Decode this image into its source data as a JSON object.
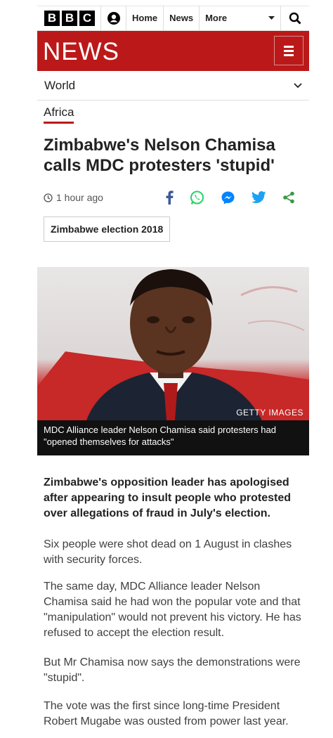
{
  "header": {
    "logo_letters": [
      "B",
      "B",
      "C"
    ],
    "nav": [
      "Home",
      "News"
    ],
    "more_label": "More",
    "account_icon": "account-icon",
    "search_icon": "search-icon"
  },
  "news_bar": {
    "title": "NEWS",
    "menu_icon": "hamburger-icon",
    "color": "#bb1919"
  },
  "section": {
    "label": "World",
    "subsection": "Africa"
  },
  "article": {
    "headline": "Zimbabwe's Nelson Chamisa calls MDC protesters 'stupid'",
    "timestamp": "1 hour ago",
    "share_icons": [
      "facebook-icon",
      "whatsapp-icon",
      "messenger-icon",
      "twitter-icon",
      "share-icon"
    ],
    "tag": "Zimbabwe election 2018",
    "image": {
      "credit": "GETTY IMAGES",
      "caption": "MDC Alliance leader Nelson Chamisa said protesters had \"opened themselves for attacks\""
    },
    "lead": "Zimbabwe's opposition leader has apologised after appearing to insult people who protested over allegations of fraud in July's election.",
    "paragraphs": [
      "Six people were shot dead on 1 August in clashes with security forces.",
      "The same day, MDC Alliance leader Nelson Chamisa said he had won the popular vote and that \"manipulation\" would not prevent his victory. He has refused to accept the election result.",
      "But Mr Chamisa now says the demonstrations were \"stupid\".",
      "The vote was the first since long-time President Robert Mugabe was ousted from power last year."
    ]
  }
}
